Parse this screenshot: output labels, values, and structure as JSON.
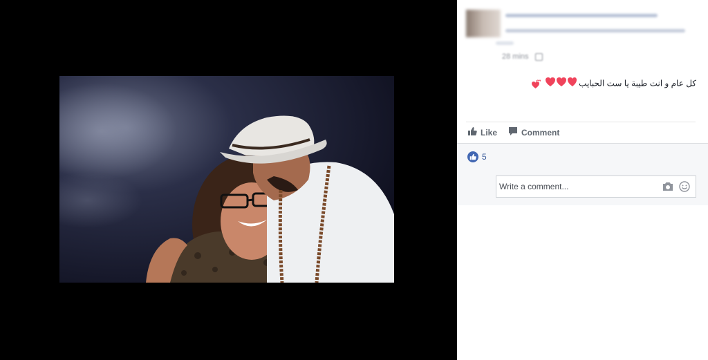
{
  "post": {
    "author_name": "",
    "timestamp": "28 mins",
    "text": "كل عام و انت طيبة يا ست الحبايب"
  },
  "actions": {
    "like_label": "Like",
    "comment_label": "Comment"
  },
  "reactions": {
    "like_count": "5"
  },
  "comment": {
    "placeholder": "Write a comment..."
  },
  "colors": {
    "accent": "#4267b2",
    "heart": "#f0435b"
  },
  "icons": [
    "thumbs-up-icon",
    "comment-icon",
    "camera-icon",
    "smiley-icon",
    "heart-icon",
    "globe-icon"
  ]
}
